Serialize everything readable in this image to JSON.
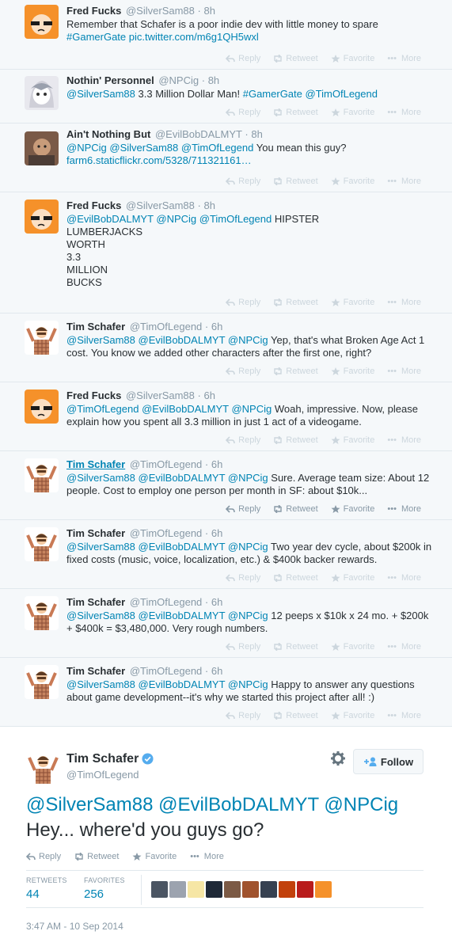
{
  "action_labels": {
    "reply": "Reply",
    "retweet": "Retweet",
    "favorite": "Favorite",
    "more": "More"
  },
  "tweets": [
    {
      "name": "Fred Fucks",
      "handle": "@SilverSam88",
      "time": "8h",
      "lines": [
        [
          "Remember that Schafer is a poor indie dev with little money to spare",
          ""
        ],
        [
          "",
          "#GamerGate pic.twitter.com/m6g1QH5wxl"
        ]
      ]
    },
    {
      "name": "Nothin' Personnel",
      "handle": "@NPCig",
      "time": "8h",
      "lines": [
        [
          "",
          "@SilverSam88",
          " 3.3 Million Dollar Man! ",
          "#GamerGate @TimOfLegend"
        ]
      ]
    },
    {
      "name": "Ain't Nothing But",
      "handle": "@EvilBobDALMYT",
      "time": "8h",
      "lines": [
        [
          "",
          "@NPCig @SilverSam88 @TimOfLegend",
          " You mean this guy?"
        ],
        [
          "",
          "farm6.staticflickr.com/5328/711321161…"
        ]
      ]
    },
    {
      "name": "Fred Fucks",
      "handle": "@SilverSam88",
      "time": "8h",
      "lines": [
        [
          "",
          "@EvilBobDALMYT @NPCig @TimOfLegend",
          " HIPSTER"
        ],
        [
          "LUMBERJACKS"
        ],
        [
          "WORTH"
        ],
        [
          "3.3"
        ],
        [
          "MILLION"
        ],
        [
          "BUCKS"
        ]
      ]
    },
    {
      "name": "Tim Schafer",
      "handle": "@TimOfLegend",
      "time": "6h",
      "lines": [
        [
          "",
          "@SilverSam88 @EvilBobDALMYT @NPCig",
          " Yep, that's what Broken Age Act 1"
        ],
        [
          "cost. You know we added other characters after the first one, right?"
        ]
      ]
    },
    {
      "name": "Fred Fucks",
      "handle": "@SilverSam88",
      "time": "6h",
      "lines": [
        [
          "",
          "@TimOfLegend @EvilBobDALMYT @NPCig",
          " Woah, impressive. Now, please"
        ],
        [
          "explain how you spent all 3.3 million in just 1 act of a videogame."
        ]
      ]
    },
    {
      "name": "Tim Schafer",
      "handle": "@TimOfLegend",
      "time": "6h",
      "lines": [
        [
          "",
          "@SilverSam88 @EvilBobDALMYT @NPCig",
          " Sure. Average team size: About 12"
        ],
        [
          "people. Cost to employ one person per month in SF: about $10k..."
        ]
      ]
    },
    {
      "name": "Tim Schafer",
      "handle": "@TimOfLegend",
      "time": "6h",
      "lines": [
        [
          "",
          "@SilverSam88 @EvilBobDALMYT @NPCig",
          " Two year dev cycle, about $200k in"
        ],
        [
          "fixed costs (music, voice, localization, etc.) & $400k backer rewards."
        ]
      ]
    },
    {
      "name": "Tim Schafer",
      "handle": "@TimOfLegend",
      "time": "6h",
      "lines": [
        [
          "",
          "@SilverSam88 @EvilBobDALMYT @NPCig",
          " 12 peeps x $10k x 24 mo. + $200k"
        ],
        [
          "+ $400k = $3,480,000. Very rough numbers."
        ]
      ]
    },
    {
      "name": "Tim Schafer",
      "handle": "@TimOfLegend",
      "time": "6h",
      "lines": [
        [
          "",
          "@SilverSam88 @EvilBobDALMYT @NPCig",
          " Happy to answer any questions"
        ],
        [
          "about game development--it's why we started this project after all! :)"
        ]
      ]
    }
  ],
  "main": {
    "name": "Tim Schafer",
    "handle": "@TimOfLegend",
    "follow": "Follow",
    "mentions": "@SilverSam88 @EvilBobDALMYT @NPCig",
    "text": "Hey... where'd you guys go?",
    "retweets_label": "RETWEETS",
    "retweets": "44",
    "favorites_label": "FAVORITES",
    "favorites": "256",
    "timestamp": "3:47 AM - 10 Sep 2014"
  },
  "colors": {
    "link": "#0084b4",
    "name": "#292f33",
    "muted": "#8899a6",
    "avatar_orange": "#f5912a"
  }
}
